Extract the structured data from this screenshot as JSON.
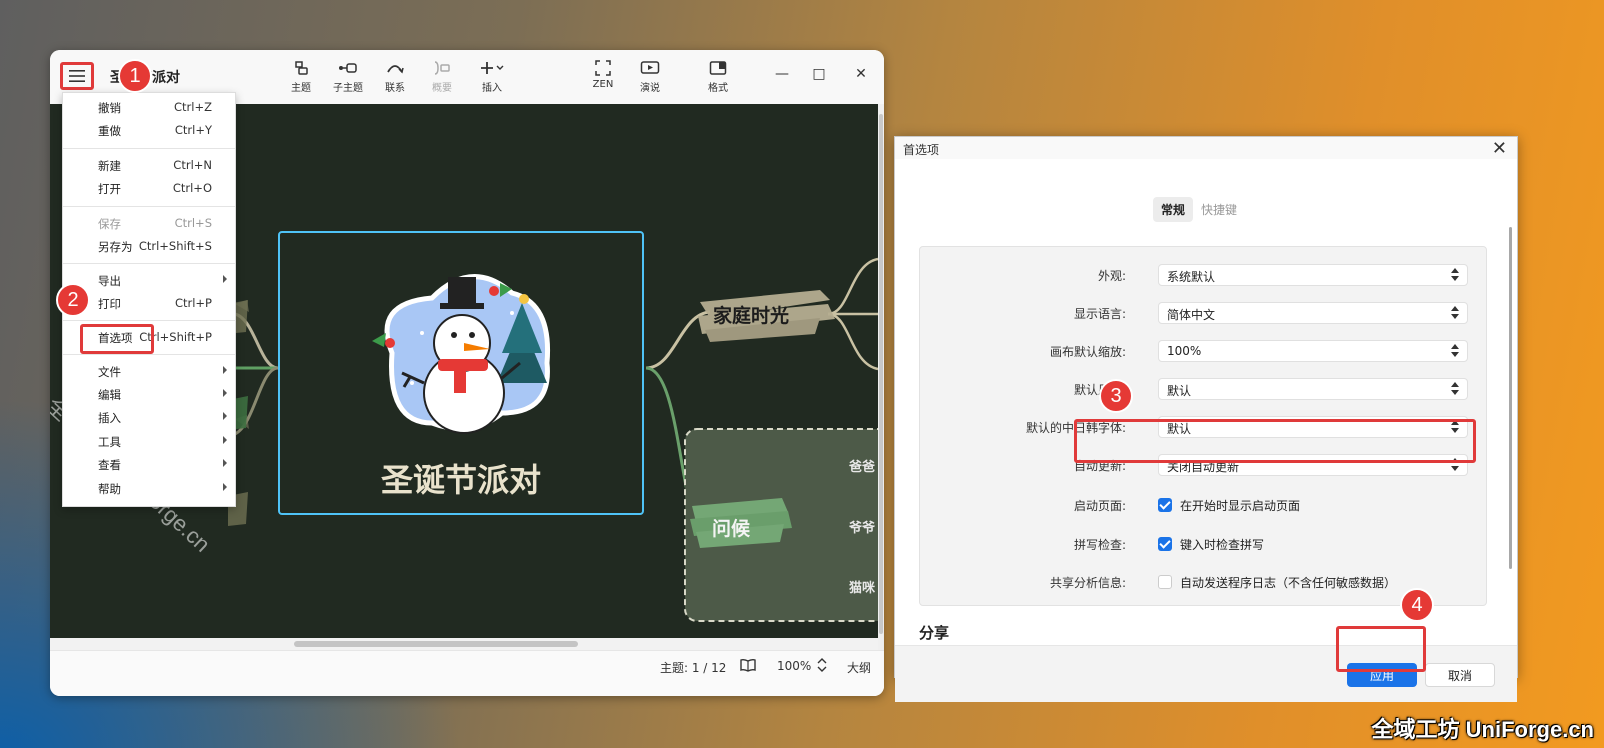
{
  "app": {
    "title": "圣诞节派对",
    "toolbar": [
      {
        "label": "主题",
        "icon": "topic-icon"
      },
      {
        "label": "子主题",
        "icon": "subtopic-icon"
      },
      {
        "label": "联系",
        "icon": "relationship-icon"
      },
      {
        "label": "概要",
        "icon": "summary-icon",
        "disabled": true
      },
      {
        "label": "插入",
        "icon": "insert-plus-icon"
      },
      {
        "label": "ZEN",
        "icon": "zen-fullscreen-icon"
      },
      {
        "label": "演说",
        "icon": "presentation-icon"
      },
      {
        "label": "格式",
        "icon": "format-panel-icon"
      }
    ],
    "window_controls": {
      "minimize": "—",
      "maximize": "□",
      "close": "✕"
    },
    "menu": {
      "items": [
        {
          "label": "撤销",
          "shortcut": "Ctrl+Z"
        },
        {
          "label": "重做",
          "shortcut": "Ctrl+Y"
        },
        {
          "label": "新建",
          "shortcut": "Ctrl+N"
        },
        {
          "label": "打开",
          "shortcut": "Ctrl+O"
        },
        {
          "label": "保存",
          "shortcut": "Ctrl+S",
          "disabled": true
        },
        {
          "label": "另存为",
          "shortcut": "Ctrl+Shift+S"
        },
        {
          "label": "导出",
          "submenu": true
        },
        {
          "label": "打印",
          "shortcut": "Ctrl+P"
        },
        {
          "label": "首选项",
          "shortcut": "Ctrl+Shift+P"
        },
        {
          "label": "文件",
          "submenu": true
        },
        {
          "label": "编辑",
          "submenu": true
        },
        {
          "label": "插入",
          "submenu": true
        },
        {
          "label": "工具",
          "submenu": true
        },
        {
          "label": "查看",
          "submenu": true
        },
        {
          "label": "帮助",
          "submenu": true
        }
      ]
    },
    "mindmap": {
      "central_topic": "圣诞节派对",
      "topics": [
        "家庭时光",
        "问候"
      ],
      "subtopics": [
        "爸爸",
        "爷爷",
        "猫咪"
      ]
    },
    "statusbar": {
      "topic_count": "主题: 1 / 12",
      "book_icon": "outline-book-icon",
      "zoom": "100%",
      "outline": "大纲"
    },
    "watermark": "全域工坊 UniForge.cn"
  },
  "badges": [
    "1",
    "2",
    "3",
    "4"
  ],
  "preferences": {
    "title": "首选项",
    "close": "✕",
    "tabs": [
      {
        "label": "常规",
        "active": true
      },
      {
        "label": "快捷键",
        "active": false
      }
    ],
    "rows": [
      {
        "label": "外观:",
        "value": "系统默认"
      },
      {
        "label": "显示语言:",
        "value": "简体中文"
      },
      {
        "label": "画布默认缩放:",
        "value": "100%"
      },
      {
        "label": "默认风格:",
        "value": "默认"
      },
      {
        "label": "默认的中日韩字体:",
        "value": "默认"
      },
      {
        "label": "自动更新:",
        "value": "关闭自动更新"
      }
    ],
    "checks": [
      {
        "label": "启动页面:",
        "text": "在开始时显示启动页面",
        "checked": true
      },
      {
        "label": "拼写检查:",
        "text": "键入时检查拼写",
        "checked": true
      },
      {
        "label": "共享分析信息:",
        "text": "自动发送程序日志（不含任何敏感数据）",
        "checked": false
      }
    ],
    "section_share": "分享",
    "apply": "应用",
    "cancel": "取消"
  },
  "brand": "全域工坊 UniForge.cn",
  "colors": {
    "accent": "#1a73e8",
    "highlight_red": "#e03a3a",
    "canvas_bg": "#212a21",
    "central_border": "#4fc3f7"
  }
}
